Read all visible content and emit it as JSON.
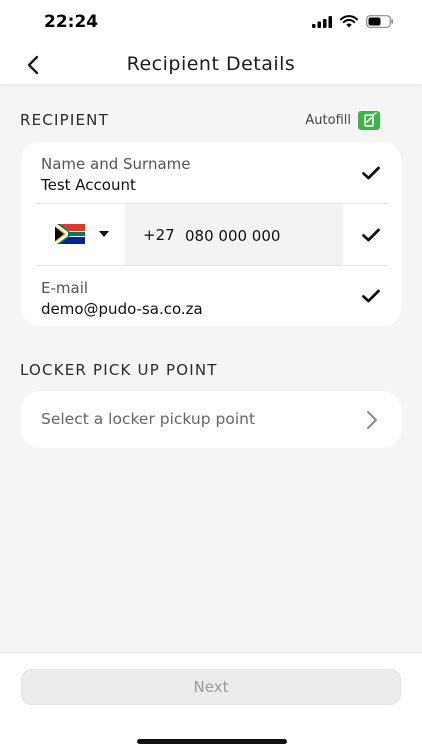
{
  "status_bar": {
    "time": "22:24"
  },
  "nav": {
    "title": "Recipient Details",
    "back_icon": "chevron-left-icon"
  },
  "recipient_section": {
    "label": "RECIPIENT",
    "autofill_label": "Autofill",
    "autofill_color": "#3cb449",
    "name_label": "Name and Surname",
    "name_value": "Test Account",
    "country_flag": "south-africa-flag",
    "dial_code": "+27",
    "phone_value": "080 000 000",
    "email_label": "E-mail",
    "email_value": "demo@pudo-sa.co.za"
  },
  "locker_section": {
    "label": "LOCKER PICK UP POINT",
    "placeholder": "Select a locker pickup point"
  },
  "footer": {
    "next_label": "Next"
  }
}
